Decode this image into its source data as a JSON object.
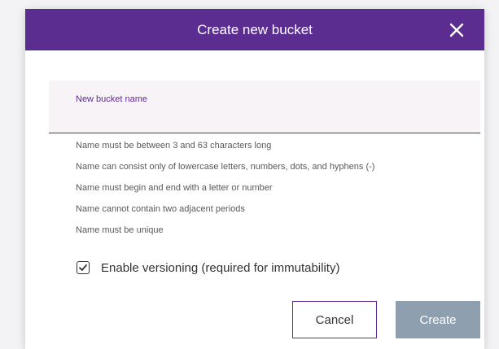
{
  "dialog": {
    "title": "Create new bucket",
    "close_icon": "close-icon"
  },
  "name_field": {
    "label": "New bucket name",
    "value": ""
  },
  "rules": [
    "Name must be between 3 and 63 characters long",
    "Name can consist only of lowercase letters, numbers, dots, and hyphens (-)",
    "Name must begin and end with a letter or number",
    "Name cannot contain two adjacent periods",
    "Name must be unique"
  ],
  "versioning": {
    "label": "Enable versioning (required for immutability)",
    "checked": true
  },
  "actions": {
    "cancel_label": "Cancel",
    "create_label": "Create"
  },
  "colors": {
    "header": "#5b2d91",
    "create_disabled": "#8ea0b0",
    "field_background": "#f8f3f6"
  }
}
